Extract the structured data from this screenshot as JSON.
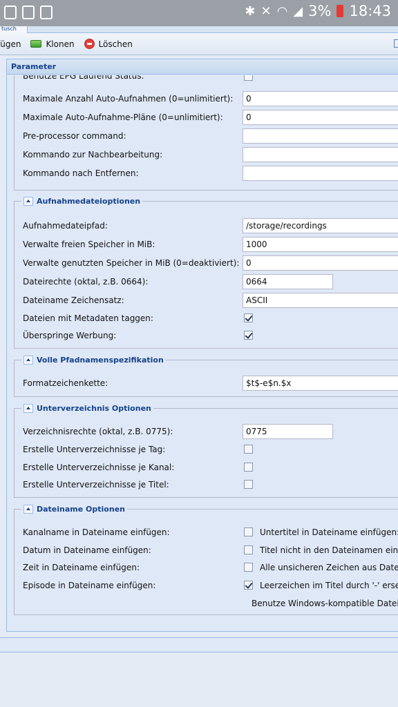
{
  "statusbar": {
    "battery": "3%",
    "time": "18:43"
  },
  "tabstrip": {
    "tab_label": "tusch"
  },
  "toolbar": {
    "insert_label": "fügen",
    "clone_label": "Klonen",
    "delete_label": "Löschen"
  },
  "panel": {
    "title": "Parameter"
  },
  "general": {
    "partial_label": "Benutze EPG Laufend Status:",
    "rows": [
      {
        "label": "Maximale Anzahl Auto-Aufnahmen (0=unlimitiert):",
        "value": "0"
      },
      {
        "label": "Maximale Auto-Aufnahme-Pläne (0=unlimitiert):",
        "value": "0"
      },
      {
        "label": "Pre-processor command:",
        "value": ""
      },
      {
        "label": "Kommando zur Nachbearbeitung:",
        "value": ""
      },
      {
        "label": "Kommando nach Entfernen:",
        "value": ""
      }
    ]
  },
  "recording_file": {
    "legend": "Aufnahmedateioptionen",
    "path_label": "Aufnahmedateipfad:",
    "path_value": "/storage/recordings",
    "free_label": "Verwalte freien Speicher in MiB:",
    "free_value": "1000",
    "used_label": "Verwalte genutzten Speicher in MiB (0=deaktiviert):",
    "used_value": "0",
    "perm_label": "Dateirechte (oktal, z.B. 0664):",
    "perm_value": "0664",
    "charset_label": "Dateiname Zeichensatz:",
    "charset_value": "ASCII",
    "tag_label": "Dateien mit Metadaten taggen:",
    "tag_checked": true,
    "skip_label": "Überspringe Werbung:",
    "skip_checked": true
  },
  "full_path": {
    "legend": "Volle Pfadnamenspezifikation",
    "format_label": "Formatzeichenkette:",
    "format_value": "$t$-e$n.$x"
  },
  "subdir": {
    "legend": "Unterverzeichnis Optionen",
    "perm_label": "Verzeichnisrechte (oktal, z.B. 0775):",
    "perm_value": "0775",
    "day_label": "Erstelle Unterverzeichnisse je Tag:",
    "day_checked": false,
    "channel_label": "Erstelle Unterverzeichnisse je Kanal:",
    "channel_checked": false,
    "title_label": "Erstelle Unterverzeichnisse je Titel:",
    "title_checked": false
  },
  "filename": {
    "legend": "Dateiname Optionen",
    "channel_label": "Kanalname in Dateiname einfügen:",
    "channel_checked": false,
    "subtitle_label": "Untertitel in Dateiname einfügen:",
    "date_label": "Datum in Dateiname einfügen:",
    "date_checked": false,
    "title_not_label": "Titel nicht in den Dateinamen einfüg",
    "time_label": "Zeit in Dateiname einfügen:",
    "time_checked": false,
    "unsafe_label": "Alle unsicheren Zeichen aus Dateina",
    "episode_label": "Episode in Dateiname einfügen:",
    "episode_checked": true,
    "spaces_label": "Leerzeichen im Titel durch '-' ersetze",
    "windows_label": "Benutze Windows-kompatible Datein"
  }
}
